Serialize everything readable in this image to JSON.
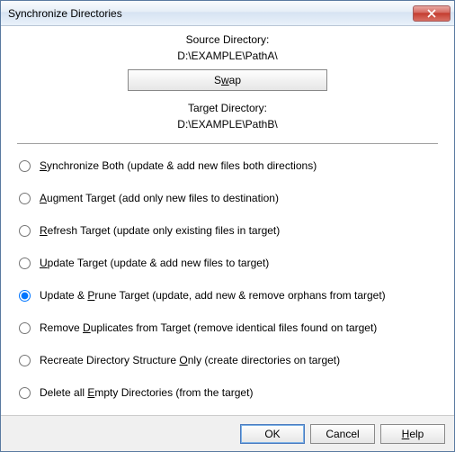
{
  "window": {
    "title": "Synchronize Directories"
  },
  "source": {
    "label": "Source Directory:",
    "path": "D:\\EXAMPLE\\PathA\\"
  },
  "target": {
    "label": "Target Directory:",
    "path": "D:\\EXAMPLE\\PathB\\"
  },
  "swap": {
    "pre": "S",
    "mn": "w",
    "post": "ap"
  },
  "options": [
    {
      "mn": "S",
      "post": "ynchronize Both (update & add new files both directions)",
      "selected": false
    },
    {
      "mn": "A",
      "post": "ugment Target (add only new files to destination)",
      "selected": false
    },
    {
      "mn": "R",
      "post": "efresh Target (update only existing files in target)",
      "selected": false
    },
    {
      "mn": "U",
      "post": "pdate Target (update & add new files to target)",
      "selected": false
    },
    {
      "pre": "Update & ",
      "mn": "P",
      "post": "rune Target (update, add new & remove orphans from target)",
      "selected": true
    },
    {
      "pre": "Remove ",
      "mn": "D",
      "post": "uplicates from Target (remove identical files found on target)",
      "selected": false
    },
    {
      "pre": "Recreate Directory Structure ",
      "mn": "O",
      "post": "nly (create directories on target)",
      "selected": false
    },
    {
      "pre": "Delete all ",
      "mn": "E",
      "post": "mpty Directories (from the target)",
      "selected": false
    }
  ],
  "buttons": {
    "ok": "OK",
    "cancel": "Cancel",
    "help_mn": "H",
    "help_post": "elp"
  }
}
